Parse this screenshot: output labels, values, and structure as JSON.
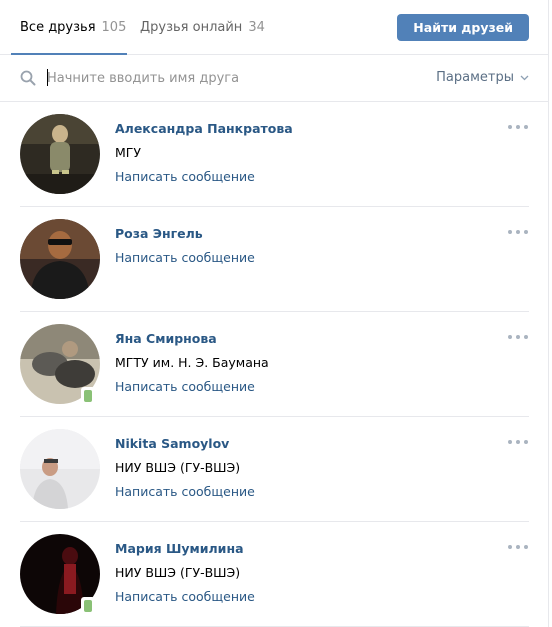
{
  "tabs": {
    "all_label": "Все друзья",
    "all_count": "105",
    "online_label": "Друзья онлайн",
    "online_count": "34"
  },
  "find_button": "Найти друзей",
  "search": {
    "placeholder": "Начните вводить имя друга",
    "params_label": "Параметры"
  },
  "friends": [
    {
      "name": "Александра Панкратова",
      "sub": "МГУ",
      "message": "Написать сообщение",
      "online_mobile": false,
      "avatar_colors": [
        "#2e2a22",
        "#8a8a6a",
        "#c9c58c"
      ]
    },
    {
      "name": "Роза Энгель",
      "sub": "",
      "message": "Написать сообщение",
      "online_mobile": false,
      "avatar_colors": [
        "#3a2a24",
        "#a66b40",
        "#1a1a1a"
      ]
    },
    {
      "name": "Яна Смирнова",
      "sub": "МГТУ им. Н. Э. Баумана",
      "message": "Написать сообщение",
      "online_mobile": true,
      "avatar_colors": [
        "#8e8878",
        "#5c5a55",
        "#c9c2b0"
      ]
    },
    {
      "name": "Nikita Samoylov",
      "sub": "НИУ ВШЭ (ГУ-ВШЭ)",
      "message": "Написать сообщение",
      "online_mobile": false,
      "avatar_colors": [
        "#e8e8ea",
        "#d4d4d6",
        "#3a3a3a"
      ]
    },
    {
      "name": "Мария Шумилина",
      "sub": "НИУ ВШЭ (ГУ-ВШЭ)",
      "message": "Написать сообщение",
      "online_mobile": true,
      "avatar_colors": [
        "#0d0606",
        "#4a0c10",
        "#8a1a20"
      ]
    }
  ]
}
